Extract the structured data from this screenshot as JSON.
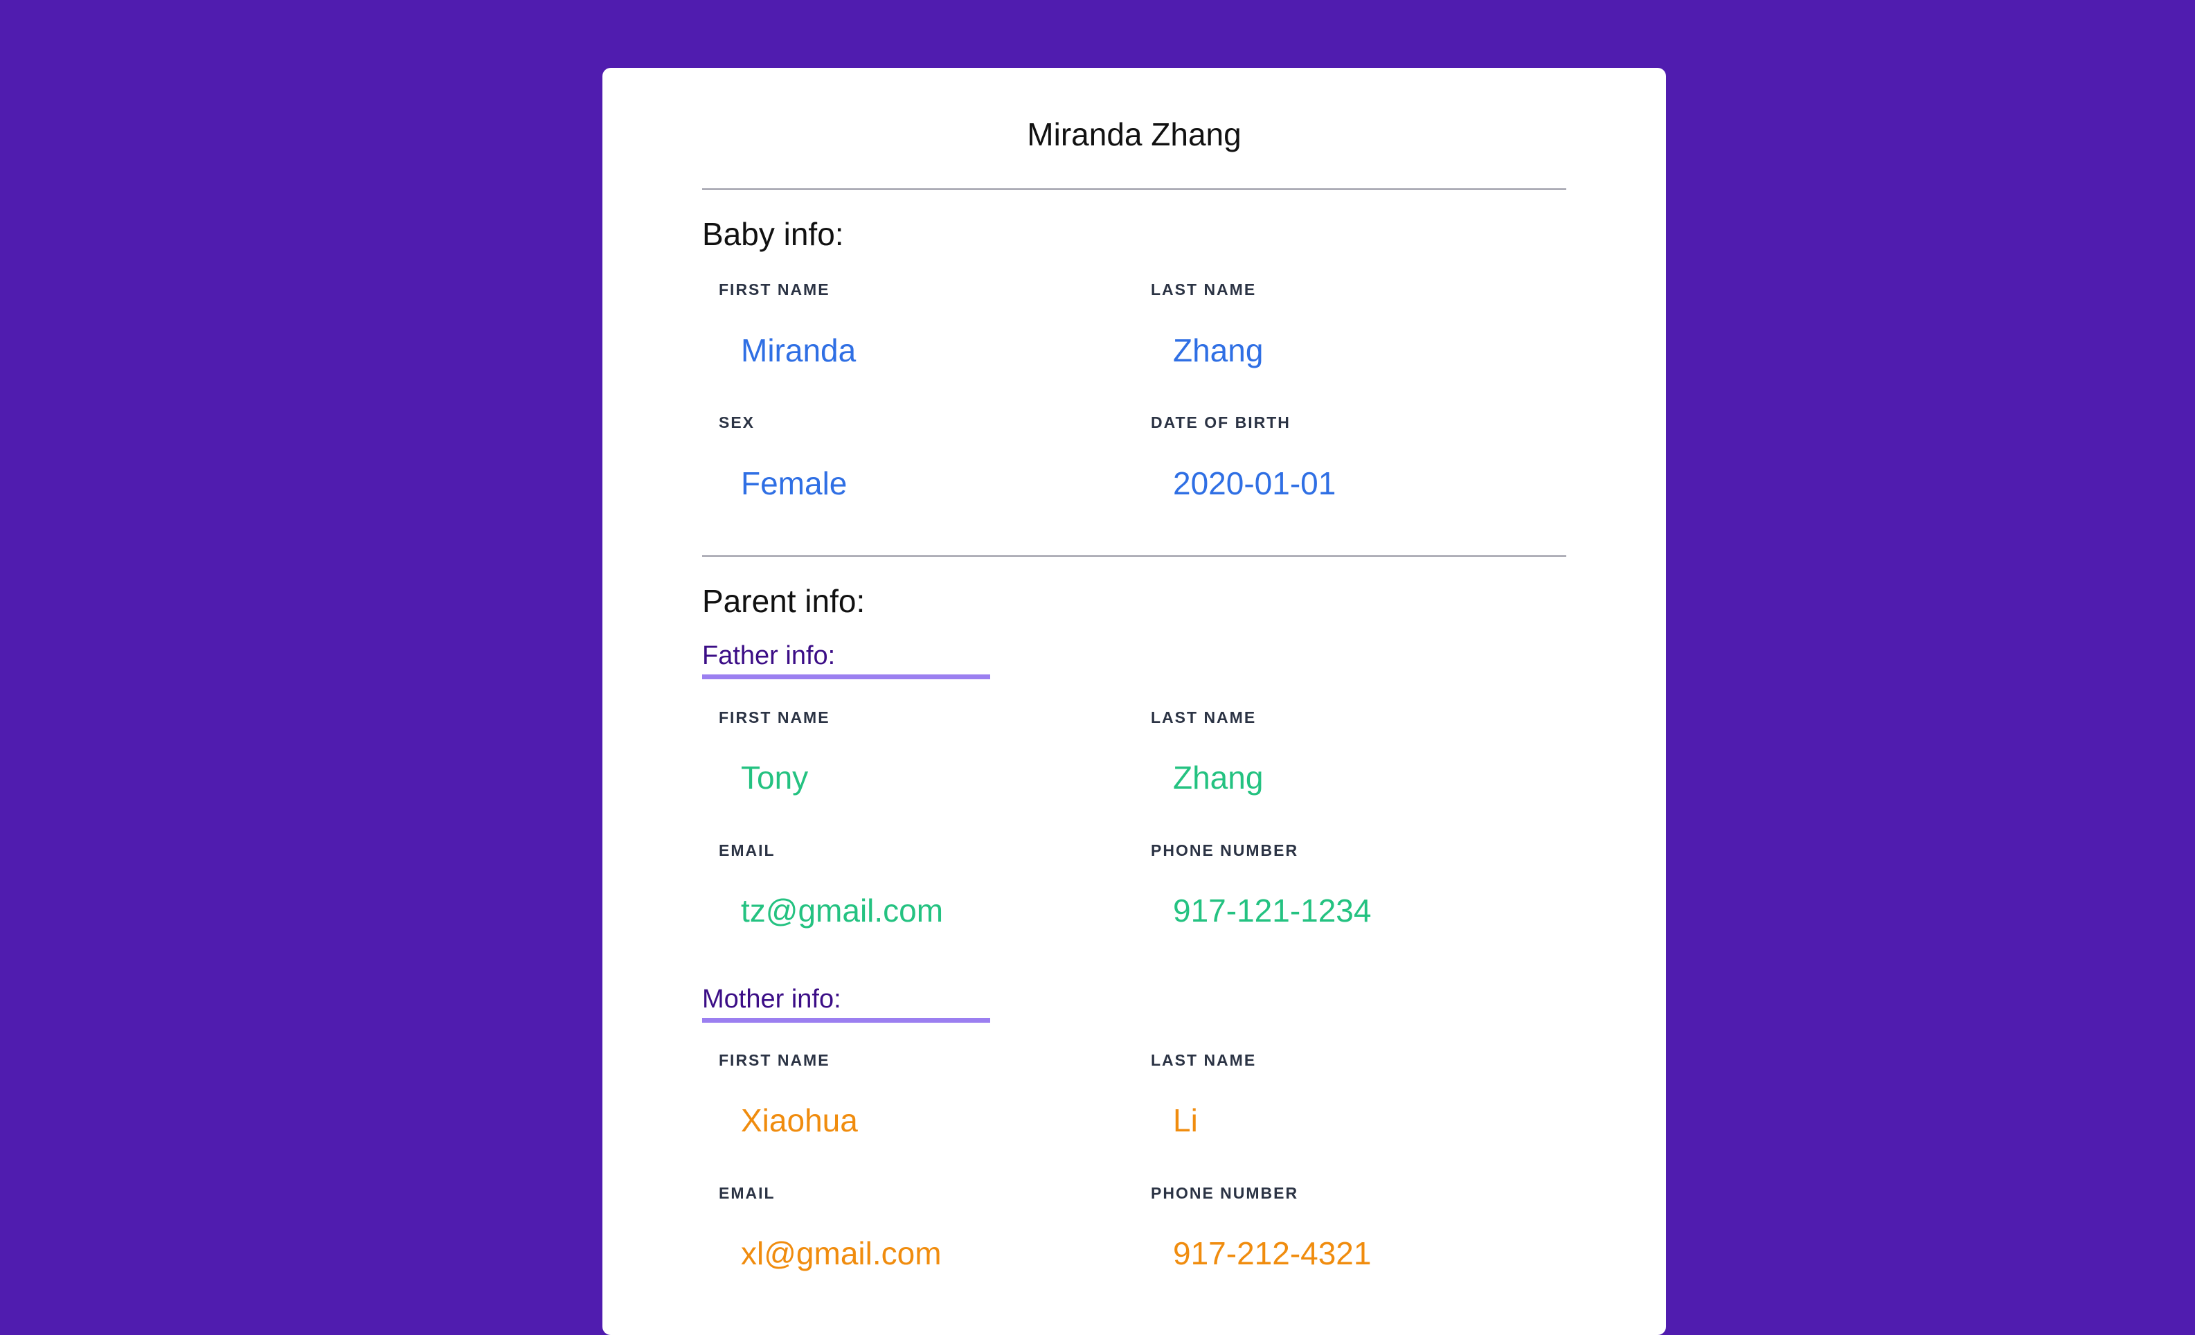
{
  "card": {
    "title": "Miranda Zhang"
  },
  "baby": {
    "heading": "Baby info:",
    "first_name_label": "FIRST NAME",
    "first_name": "Miranda",
    "last_name_label": "LAST NAME",
    "last_name": "Zhang",
    "sex_label": "SEX",
    "sex": "Female",
    "dob_label": "DATE OF BIRTH",
    "dob": "2020-01-01"
  },
  "parent": {
    "heading": "Parent info:",
    "father": {
      "heading": "Father info:",
      "first_name_label": "FIRST NAME",
      "first_name": "Tony",
      "last_name_label": "LAST NAME",
      "last_name": "Zhang",
      "email_label": "EMAIL",
      "email": "tz@gmail.com",
      "phone_label": "PHONE NUMBER",
      "phone": "917-121-1234"
    },
    "mother": {
      "heading": "Mother info:",
      "first_name_label": "FIRST NAME",
      "first_name": "Xiaohua",
      "last_name_label": "LAST NAME",
      "last_name": "Li",
      "email_label": "EMAIL",
      "email": "xl@gmail.com",
      "phone_label": "PHONE NUMBER",
      "phone": "917-212-4321"
    }
  },
  "colors": {
    "background": "#501caf",
    "baby_value": "#2f6fe4",
    "father_value": "#24c281",
    "mother_value": "#f08c0e",
    "subheading": "#3b0d86",
    "subheading_underline": "#9b7ff0"
  }
}
